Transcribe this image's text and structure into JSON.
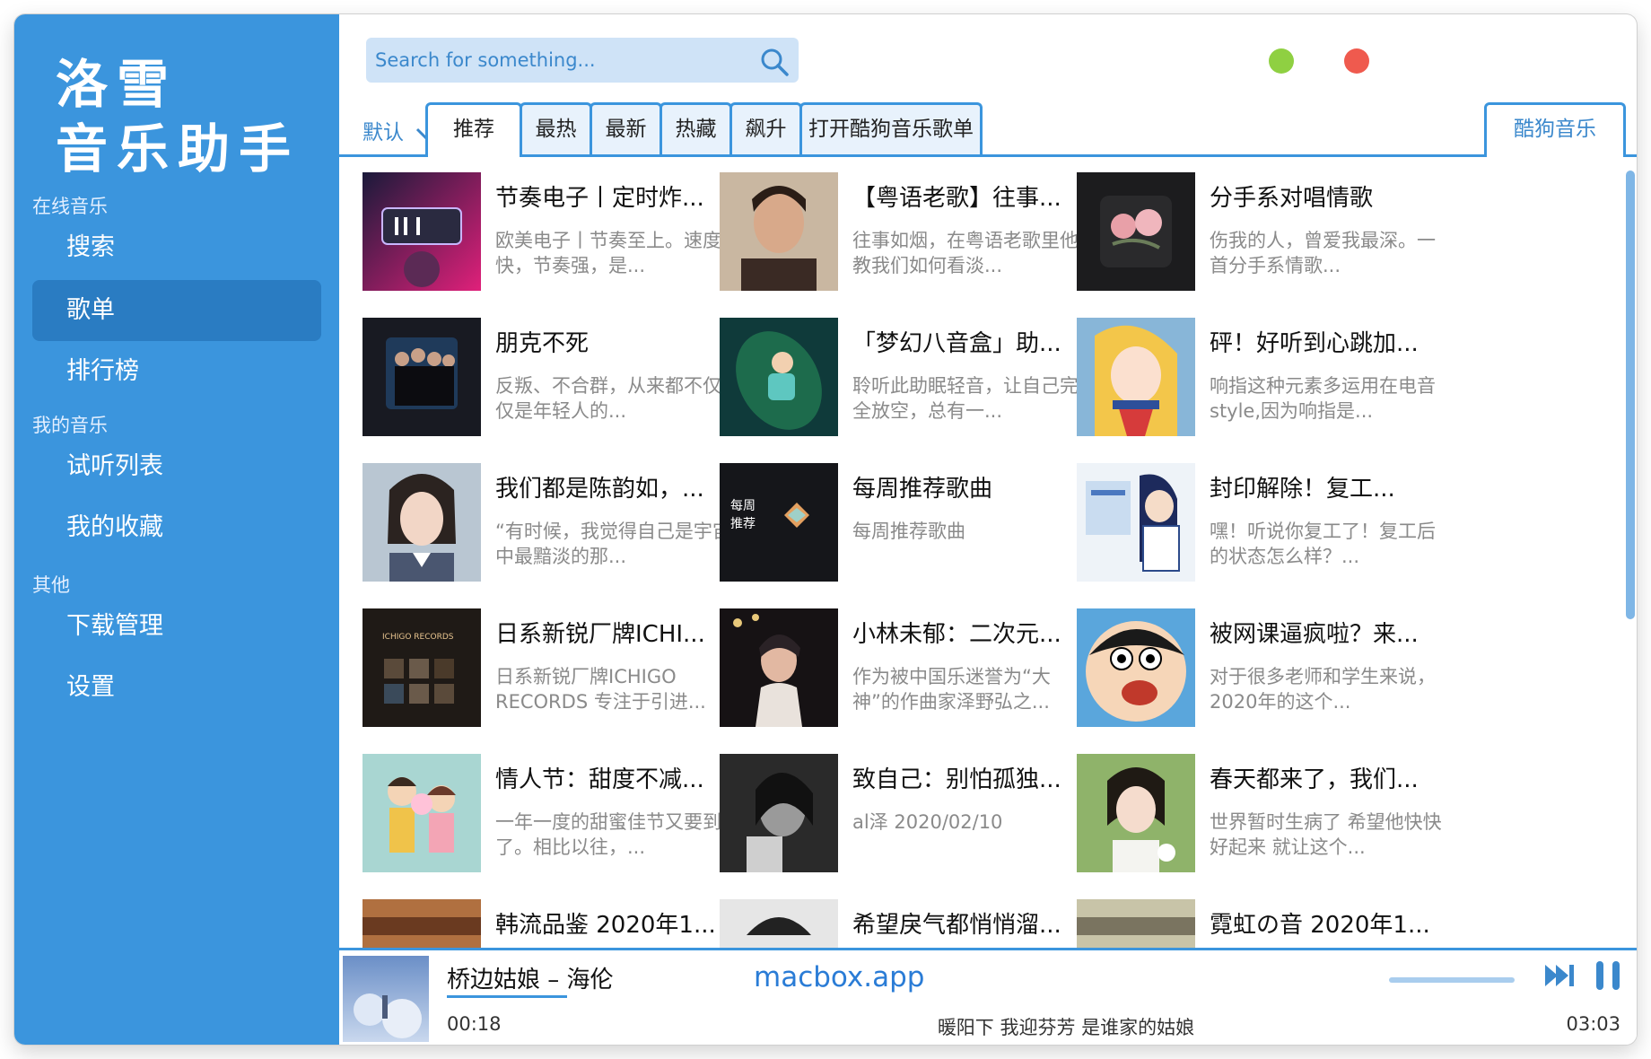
{
  "sidebar": {
    "logo_line1": "洛雪",
    "logo_line2": "音乐助手",
    "sections": [
      {
        "title": "在线音乐",
        "items": [
          "搜索",
          "歌单",
          "排行榜"
        ]
      },
      {
        "title": "我的音乐",
        "items": [
          "试听列表",
          "我的收藏"
        ]
      },
      {
        "title": "其他",
        "items": [
          "下载管理",
          "设置"
        ]
      }
    ]
  },
  "search": {
    "placeholder": "Search for something..."
  },
  "window_controls": {
    "min_color": "#8fd042",
    "close_color": "#ef5a4e"
  },
  "tabs": {
    "sort_label": "默认",
    "items": [
      "推荐",
      "最热",
      "最新",
      "热藏",
      "飙升",
      "打开酷狗音乐歌单"
    ],
    "source": "酷狗音乐"
  },
  "playlists": [
    {
      "title": "节奏电子丨定时炸...",
      "desc": "欧美电子丨节奏至上。速度快，节奏强，是..."
    },
    {
      "title": "【粤语老歌】往事...",
      "desc": "往事如烟，在粤语老歌里他教我们如何看淡..."
    },
    {
      "title": "分手系对唱情歌",
      "desc": "伤我的人，曾爱我最深。一首分手系情歌..."
    },
    {
      "title": "朋克不死",
      "desc": "反叛、不合群，从来都不仅仅是年轻人的..."
    },
    {
      "title": "「梦幻八音盒」助...",
      "desc": "聆听此助眠轻音，让自己完全放空，总有一..."
    },
    {
      "title": "砰！好听到心跳加...",
      "desc": "响指这种元素多运用在电音style,因为响指是..."
    },
    {
      "title": "我们都是陈韵如，...",
      "desc": "“有时候，我觉得自己是宇宙中最黯淡的那..."
    },
    {
      "title": "每周推荐歌曲",
      "desc": "每周推荐歌曲"
    },
    {
      "title": "封印解除！复工...",
      "desc": "嘿！听说你复工了！复工后的状态怎么样？..."
    },
    {
      "title": "日系新锐厂牌ICHI...",
      "desc": "日系新锐厂牌ICHIGO RECORDS 专注于引进..."
    },
    {
      "title": "小林未郁：二次元...",
      "desc": "作为被中国乐迷誉为“大神”的作曲家泽野弘之..."
    },
    {
      "title": "被网课逼疯啦？来...",
      "desc": "对于很多老师和学生来说，2020年的这个..."
    },
    {
      "title": "情人节：甜度不减...",
      "desc": "一年一度的甜蜜佳节又要到了。相比以往，..."
    },
    {
      "title": "致自己：别怕孤独...",
      "desc": "al泽 2020/02/10"
    },
    {
      "title": "春天都来了，我们...",
      "desc": "世界暂时生病了 希望他快快好起来 就让这个..."
    },
    {
      "title": "韩流品鉴 2020年1...",
      "desc": ""
    },
    {
      "title": "希望戾气都悄悄溜...",
      "desc": ""
    },
    {
      "title": "霓虹の音 2020年1...",
      "desc": ""
    }
  ],
  "cover_text": {
    "weekly_line1": "每周",
    "weekly_line2": "推荐",
    "ichigo": "ICHIGO RECORDS"
  },
  "player": {
    "song": "桥边姑娘 – 海伦",
    "watermark": "macbox.app",
    "current_time": "00:18",
    "total_time": "03:03",
    "lyric": "暖阳下 我迎芬芳 是谁家的姑娘",
    "progress": 0.098
  },
  "accent": "#3b95dd"
}
